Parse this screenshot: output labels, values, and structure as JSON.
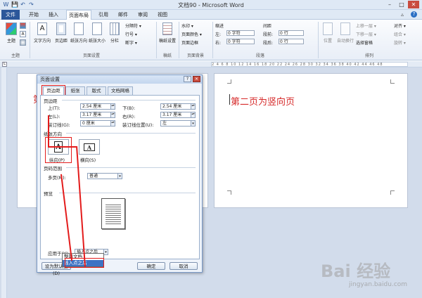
{
  "window": {
    "title": "文档90 - Microsoft Word",
    "minimize": "–",
    "maximize": "□",
    "close": "✕"
  },
  "quick_access": {
    "save": "💾",
    "undo": "↶",
    "redo": "↷"
  },
  "tabs": [
    "文件",
    "开始",
    "插入",
    "页面布局",
    "引用",
    "邮件",
    "审阅",
    "视图"
  ],
  "ribbon": {
    "groups": {
      "theme": {
        "name": "主题",
        "button": "主题"
      },
      "page_setup": {
        "name": "页面设置",
        "buttons": [
          "文字方向",
          "页边距",
          "纸张方向",
          "纸张大小",
          "分栏"
        ],
        "small": [
          "分隔符 ▾",
          "行号 ▾",
          "断字 ▾"
        ]
      },
      "manuscript": {
        "name": "稿纸",
        "button": "稿纸设置"
      },
      "page_background": {
        "name": "页面背景",
        "items": [
          "水印 ▾",
          "页面颜色 ▾",
          "页面边框"
        ]
      },
      "paragraph": {
        "name": "段落",
        "indent_label": "缩进",
        "spacing_label": "间距",
        "left_label": "左:",
        "right_label": "右:",
        "before_label": "段前:",
        "after_label": "段后:",
        "indent_left": "0 字符",
        "indent_right": "0 字符",
        "spacing_before": "0 行",
        "spacing_after": "0 行"
      },
      "arrange": {
        "name": "排列",
        "buttons": [
          "位置",
          "自动换行"
        ],
        "small": [
          "上移一层 ▾",
          "下移一层 ▾",
          "选择窗格",
          "对齐 ▾",
          "组合 ▾",
          "旋转 ▾"
        ]
      }
    }
  },
  "ruler": {
    "marks": "2 4 6 8 10 12 14 16 18 20 22 24 26 28 30 32 34 36 38 40 42 44 46 48"
  },
  "document": {
    "page1_text": "第",
    "page2_text": "第二页为竖向页"
  },
  "dialog": {
    "title": "页面设置",
    "help": "?",
    "close": "✕",
    "tabs": [
      "页边距",
      "纸张",
      "版式",
      "文档网格"
    ],
    "margins_section": "页边距",
    "margins": [
      {
        "label": "上(T):",
        "value": "2.54 厘米"
      },
      {
        "label": "下(B):",
        "value": "2.54 厘米"
      },
      {
        "label": "左(L):",
        "value": "3.17 厘米"
      },
      {
        "label": "右(R):",
        "value": "3.17 厘米"
      },
      {
        "label": "装订线(G):",
        "value": "0 厘米"
      },
      {
        "label": "装订线位置(U):",
        "value": "左"
      }
    ],
    "orientation_section": "纸张方向",
    "portrait": "纵向(P)",
    "landscape": "横向(S)",
    "pages_section": "页码范围",
    "multiple_pages_label": "多页(M):",
    "multiple_pages_value": "普通",
    "preview_section": "预览",
    "apply_to_label": "应用于(Y):",
    "apply_to_value": "插入点之后",
    "apply_options": [
      "整篇文档",
      "插入点之后"
    ],
    "default_button": "设为默认值(D)",
    "ok_button": "确定",
    "cancel_button": "取消",
    "orient_glyph": "A"
  },
  "watermark": {
    "logo": "Bai 经验",
    "url": "jingyan.baidu.com"
  }
}
